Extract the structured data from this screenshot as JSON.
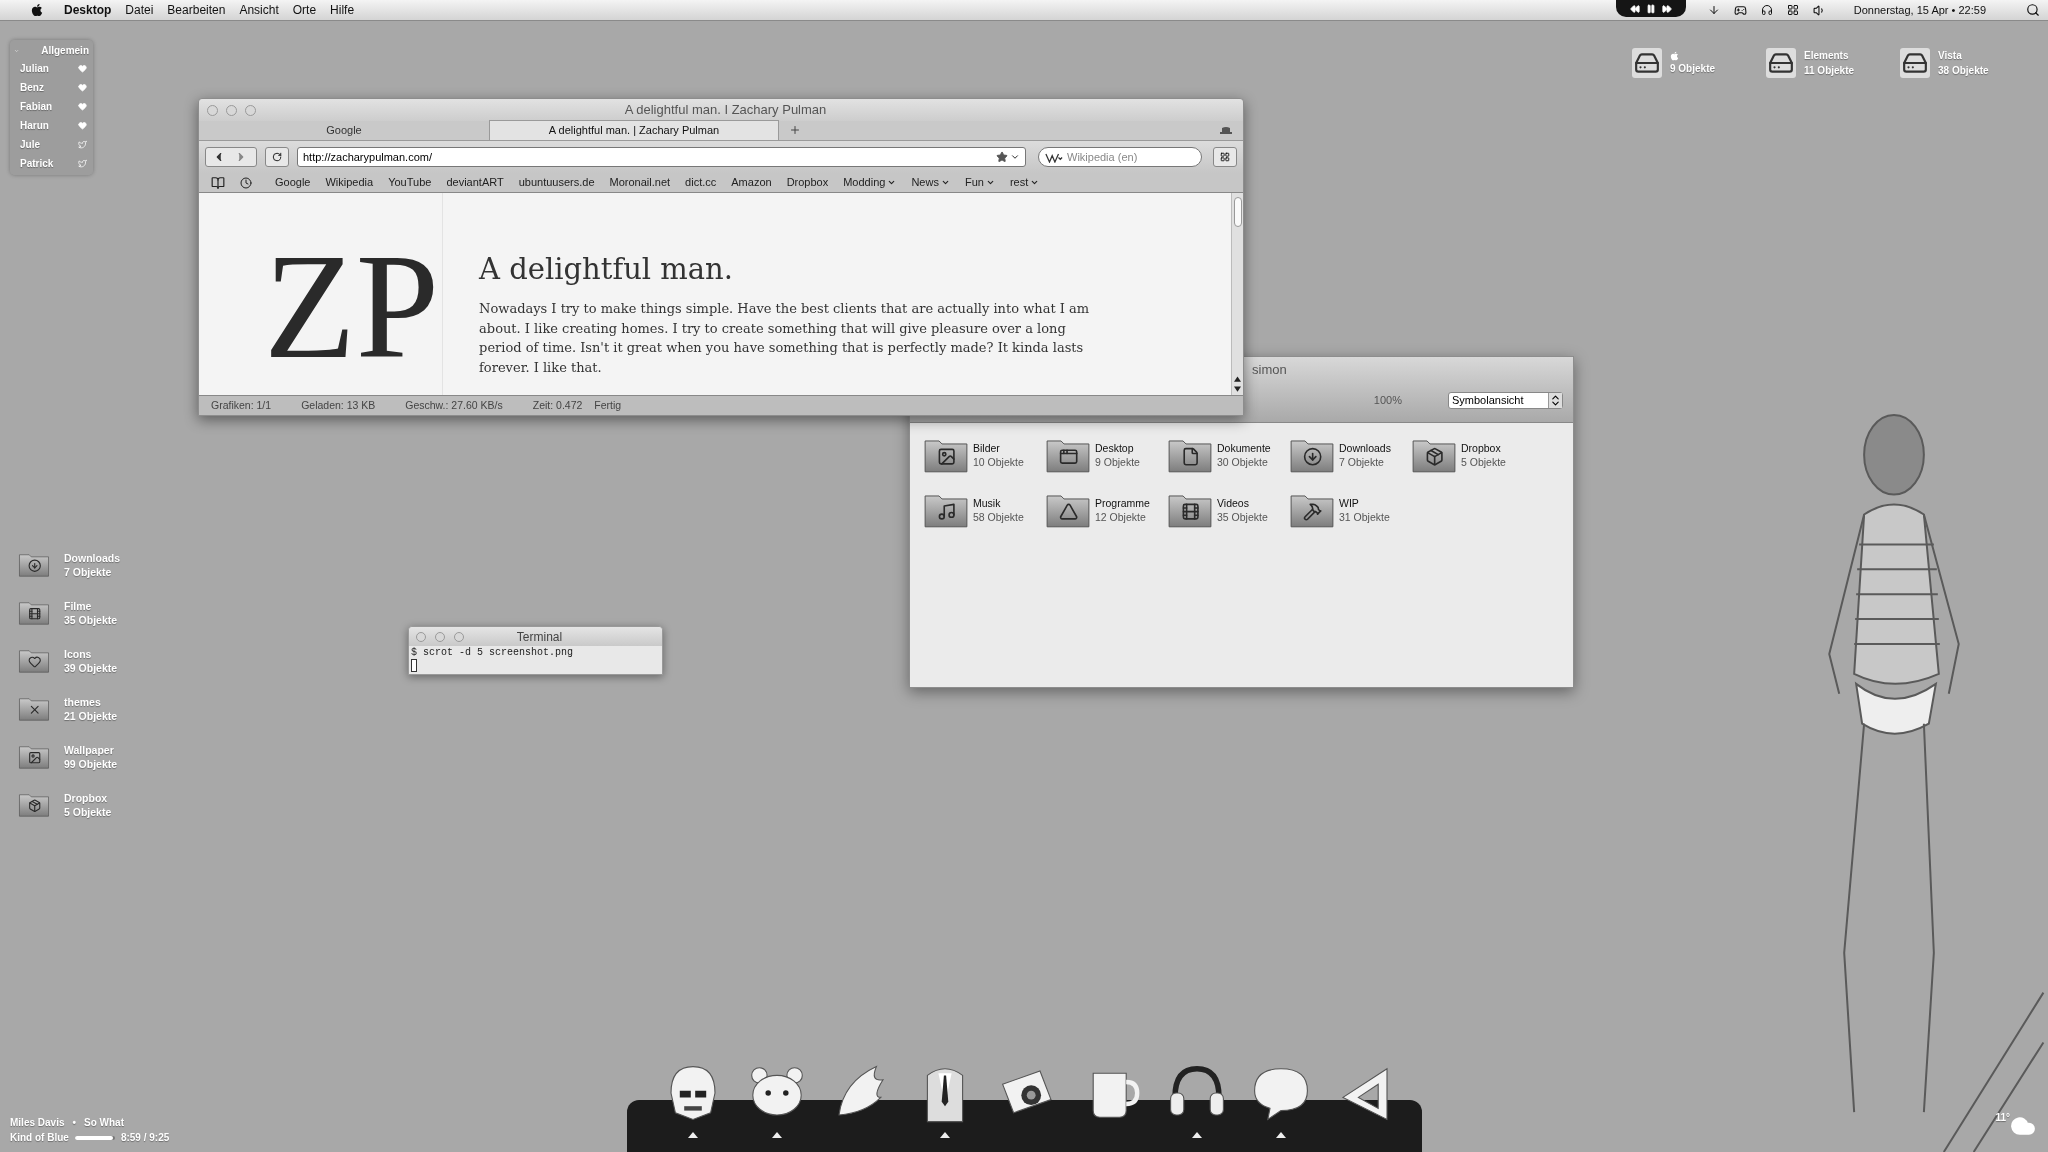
{
  "menu_bar": {
    "app": "Desktop",
    "menus": [
      "Datei",
      "Bearbeiten",
      "Ansicht",
      "Orte",
      "Hilfe"
    ],
    "clock": "Donnerstag, 15 Apr • 22:59"
  },
  "contacts_widget": {
    "title": "Allgemein",
    "expanded": true,
    "items": [
      {
        "name": "Julian",
        "kind": "heart"
      },
      {
        "name": "Benz",
        "kind": "heart"
      },
      {
        "name": "Fabian",
        "kind": "heart"
      },
      {
        "name": "Harun",
        "kind": "heart"
      },
      {
        "name": "Jule",
        "kind": "twitter"
      },
      {
        "name": "Patrick",
        "kind": "twitter"
      }
    ]
  },
  "drives": [
    {
      "kind": "apple",
      "count": "9 Objekte"
    },
    {
      "kind": "text",
      "name": "Elements",
      "count": "11 Objekte"
    },
    {
      "kind": "text",
      "name": "Vista",
      "count": "38 Objekte"
    }
  ],
  "browser": {
    "title": "A delightful man. I Zachary Pulman",
    "tabs": [
      {
        "label": "Google",
        "selected": false
      },
      {
        "label": "A delightful man. | Zachary Pulman",
        "selected": true
      }
    ],
    "url": "http://zacharypulman.com/",
    "search_placeholder": "Wikipedia (en)",
    "bookmarks": [
      {
        "label": "Google",
        "kind": "link"
      },
      {
        "label": "Wikipedia",
        "kind": "link"
      },
      {
        "label": "YouTube",
        "kind": "link"
      },
      {
        "label": "deviantART",
        "kind": "link"
      },
      {
        "label": "ubuntuusers.de",
        "kind": "link"
      },
      {
        "label": "Moronail.net",
        "kind": "link"
      },
      {
        "label": "dict.cc",
        "kind": "link"
      },
      {
        "label": "Amazon",
        "kind": "link"
      },
      {
        "label": "Dropbox",
        "kind": "link"
      },
      {
        "label": "Modding",
        "kind": "folder"
      },
      {
        "label": "News",
        "kind": "folder"
      },
      {
        "label": "Fun",
        "kind": "folder"
      },
      {
        "label": "rest",
        "kind": "folder"
      }
    ],
    "page": {
      "logo": "ZP",
      "heading": "A delightful man.",
      "body": "Nowadays I try to make things simple. Have the best clients that are actually into what I am about. I like creating homes. I try to create something that will give pleasure over a long period of time. Isn't it great when you have something that is perfectly made? It kinda lasts forever. I like that."
    },
    "status": [
      "Grafiken: 1/1",
      "Geladen: 13 KB",
      "Geschw.: 27.60 KB/s",
      "Zeit: 0.472",
      "Fertig"
    ]
  },
  "file_manager": {
    "title": "simon",
    "zoom": "100%",
    "view": "Symbolansicht",
    "items": [
      {
        "name": "Bilder",
        "count": "10 Objekte",
        "kind": "image"
      },
      {
        "name": "Desktop",
        "count": "9 Objekte",
        "kind": "screen"
      },
      {
        "name": "Dokumente",
        "count": "30 Objekte",
        "kind": "document"
      },
      {
        "name": "Downloads",
        "count": "7 Objekte",
        "kind": "download"
      },
      {
        "name": "Dropbox",
        "count": "5 Objekte",
        "kind": "dropbox"
      },
      {
        "name": "Musik",
        "count": "58 Objekte",
        "kind": "music"
      },
      {
        "name": "Programme",
        "count": "12 Objekte",
        "kind": "apps"
      },
      {
        "name": "Videos",
        "count": "35 Objekte",
        "kind": "film"
      },
      {
        "name": "WIP",
        "count": "31 Objekte",
        "kind": "hammer"
      }
    ]
  },
  "desktop_icons": [
    {
      "name": "Downloads",
      "count": "7 Objekte",
      "kind": "download"
    },
    {
      "name": "Filme",
      "count": "35 Objekte",
      "kind": "film"
    },
    {
      "name": "Icons",
      "count": "39 Objekte",
      "kind": "heart"
    },
    {
      "name": "themes",
      "count": "21 Objekte",
      "kind": "x"
    },
    {
      "name": "Wallpaper",
      "count": "99 Objekte",
      "kind": "image"
    },
    {
      "name": "Dropbox",
      "count": "5 Objekte",
      "kind": "dropbox"
    }
  ],
  "terminal": {
    "title": "Terminal",
    "command": "$ scrot -d 5 screenshot.png"
  },
  "now_playing": {
    "artist": "Miles Davis",
    "separator": "•",
    "track": "So What",
    "album": "Kind of Blue",
    "level": 0.95,
    "time": "8:59 / 9:25"
  },
  "weather": {
    "temperature": "11°"
  },
  "dock": [
    {
      "kind": "helmet",
      "running": true
    },
    {
      "kind": "bear",
      "running": true
    },
    {
      "kind": "wing",
      "running": false
    },
    {
      "kind": "suit",
      "running": true
    },
    {
      "kind": "camera",
      "running": false
    },
    {
      "kind": "mug",
      "running": false
    },
    {
      "kind": "headphones",
      "running": true
    },
    {
      "kind": "bubble",
      "running": true
    },
    {
      "kind": "triangle",
      "running": false
    }
  ]
}
